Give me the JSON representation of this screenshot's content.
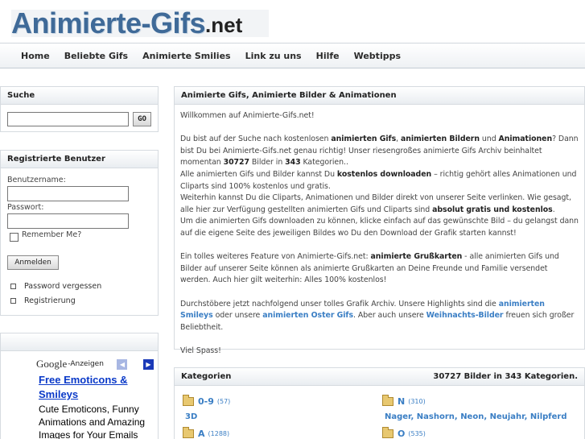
{
  "logo": {
    "main": "Animierte-Gifs",
    "tld": ".net"
  },
  "nav": {
    "items": [
      "Home",
      "Beliebte Gifs",
      "Animierte Smilies",
      "Link zu uns",
      "Hilfe",
      "Webtipps"
    ]
  },
  "search": {
    "title": "Suche",
    "button": "GO"
  },
  "login": {
    "title": "Registrierte Benutzer",
    "username_label": "Benutzername:",
    "password_label": "Passwort:",
    "remember_label": "Remember Me?",
    "submit_label": "Anmelden",
    "links": [
      "Password vergessen",
      "Registrierung"
    ]
  },
  "ad": {
    "google": "Google",
    "suffix": "-Anzeigen",
    "title": "Free Emoticons & Smileys",
    "text": "Cute Emoticons, Funny Animations and Amazing Images for Your Emails"
  },
  "main": {
    "title": "Animierte Gifs, Animierte Bilder & Animationen",
    "welcome": "Willkommen auf Animierte-Gifs.net!",
    "p2": {
      "t1": "Du bist auf der Suche nach kostenlosen ",
      "b1": "animierten Gifs",
      "t2": ", ",
      "b2": "animierten Bildern",
      "t3": " und ",
      "b3": "Animationen",
      "t4": "? Dann bist Du bei Animierte-Gifs.net genau richtig! Unser riesengroßes animierte Gifs Archiv beinhaltet momentan ",
      "b4": "30727",
      "t5": " Bilder in ",
      "b5": "343",
      "t6": " Kategorien..",
      "t7": "Alle animierten Gifs und Bilder kannst Du ",
      "b6": "kostenlos downloaden",
      "t8": " – richtig gehört alles Animationen und Cliparts sind 100% kostenlos und gratis.",
      "t9": "Weiterhin kannst Du die Cliparts, Animationen und Bilder direkt von unserer Seite verlinken. Wie gesagt, alle hier zur Verfügung gestellten animierten Gifs und Cliparts sind ",
      "b7": "absolut gratis und kostenlos",
      "t10": ".",
      "t11": "Um die animierten Gifs downloaden zu können, klicke einfach auf das gewünschte Bild – du gelangst dann auf die eigene Seite des jeweiligen Bildes wo Du den Download der Grafik starten kannst!"
    },
    "p3": {
      "t1": "Ein tolles weiteres Feature von Animierte-Gifs.net: ",
      "b1": "animierte Grußkarten",
      "t2": " - alle animierten Gifs und Bilder auf unserer Seite können als animierte Grußkarten an Deine Freunde und Familie versendet werden. Auch hier gilt weiterhin: Alles 100% kostenlos!"
    },
    "p4": {
      "t1": "Durchstöbere jetzt nachfolgend unser tolles Grafik Archiv. Unsere Highlights sind die ",
      "a1": "animierten Smileys",
      "t2": " oder unsere ",
      "a2": "animierten Oster Gifs",
      "t3": ". Aber auch unsere ",
      "a3": "Weihnachts-Bilder",
      "t4": " freuen sich großer Beliebtheit."
    },
    "bye": "Viel Spass!"
  },
  "categories": {
    "title": "Kategorien",
    "summary": "30727 Bilder in 343 Kategorien.",
    "left": [
      {
        "name": "0-9",
        "count": "(57)",
        "sub": "3D"
      },
      {
        "name": "A",
        "count": "(1288)",
        "sub": ""
      }
    ],
    "right": [
      {
        "name": "N",
        "count": "(310)",
        "sub": "Nager, Nashorn, Neon, Neujahr, Nilpferd"
      },
      {
        "name": "O",
        "count": "(535)",
        "sub": ""
      }
    ]
  }
}
